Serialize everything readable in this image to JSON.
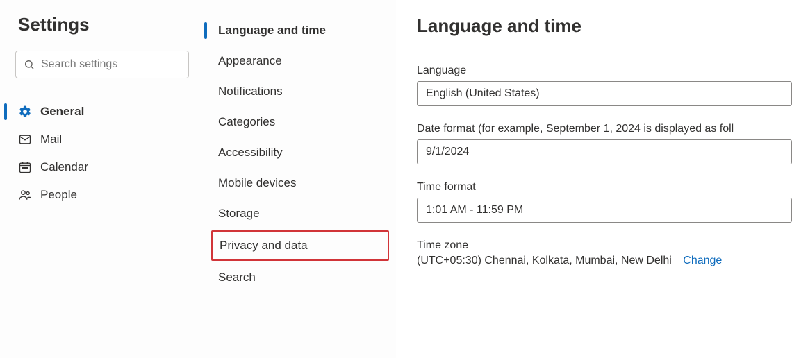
{
  "sidebar": {
    "title": "Settings",
    "search_placeholder": "Search settings",
    "items": [
      {
        "label": "General",
        "icon": "gear",
        "active": true
      },
      {
        "label": "Mail",
        "icon": "mail",
        "active": false
      },
      {
        "label": "Calendar",
        "icon": "calendar",
        "active": false
      },
      {
        "label": "People",
        "icon": "people",
        "active": false
      }
    ]
  },
  "subnav": {
    "items": [
      {
        "label": "Language and time",
        "active": true,
        "highlight": false
      },
      {
        "label": "Appearance",
        "active": false,
        "highlight": false
      },
      {
        "label": "Notifications",
        "active": false,
        "highlight": false
      },
      {
        "label": "Categories",
        "active": false,
        "highlight": false
      },
      {
        "label": "Accessibility",
        "active": false,
        "highlight": false
      },
      {
        "label": "Mobile devices",
        "active": false,
        "highlight": false
      },
      {
        "label": "Storage",
        "active": false,
        "highlight": false
      },
      {
        "label": "Privacy and data",
        "active": false,
        "highlight": true
      },
      {
        "label": "Search",
        "active": false,
        "highlight": false
      }
    ]
  },
  "main": {
    "heading": "Language and time",
    "language": {
      "label": "Language",
      "value": "English (United States)"
    },
    "date_format": {
      "label": "Date format (for example, September 1, 2024 is displayed as foll",
      "value": "9/1/2024"
    },
    "time_format": {
      "label": "Time format",
      "value": "1:01 AM - 11:59 PM"
    },
    "time_zone": {
      "label": "Time zone",
      "value": "(UTC+05:30) Chennai, Kolkata, Mumbai, New Delhi",
      "change_label": "Change"
    }
  }
}
